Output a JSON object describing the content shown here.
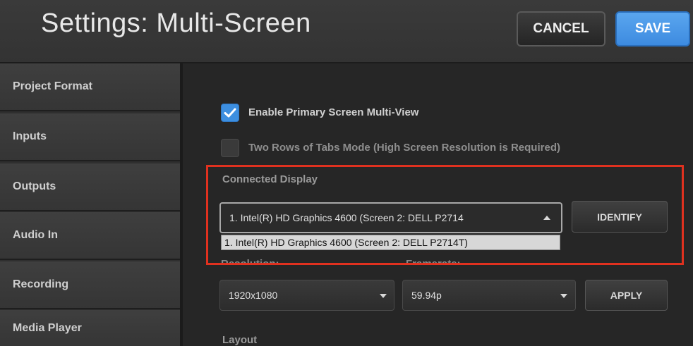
{
  "header": {
    "title": "Settings: Multi-Screen",
    "cancel_label": "CANCEL",
    "save_label": "SAVE"
  },
  "sidebar": {
    "items": [
      {
        "label": "Project Format"
      },
      {
        "label": "Inputs"
      },
      {
        "label": "Outputs"
      },
      {
        "label": "Audio In"
      },
      {
        "label": "Recording"
      },
      {
        "label": "Media Player"
      }
    ]
  },
  "main": {
    "enable_primary": {
      "label": "Enable Primary Screen Multi-View",
      "checked": true
    },
    "two_rows": {
      "label": "Two Rows of Tabs Mode (High Screen Resolution is Required)",
      "checked": false
    },
    "connected_display": {
      "label": "Connected Display",
      "selected": "1. Intel(R) HD Graphics 4600 (Screen 2: DELL P2714",
      "options": [
        "1. Intel(R) HD Graphics 4600 (Screen 2: DELL P2714T)"
      ]
    },
    "identify_label": "IDENTIFY",
    "resolution": {
      "label": "Resolution:",
      "value": "1920x1080"
    },
    "framerate": {
      "label": "Framerate:",
      "value": "59.94p"
    },
    "apply_label": "APPLY",
    "layout_label": "Layout"
  },
  "colors": {
    "accent": "#3d8be0",
    "highlight": "#e0311f",
    "text": "#e8e8e8"
  }
}
